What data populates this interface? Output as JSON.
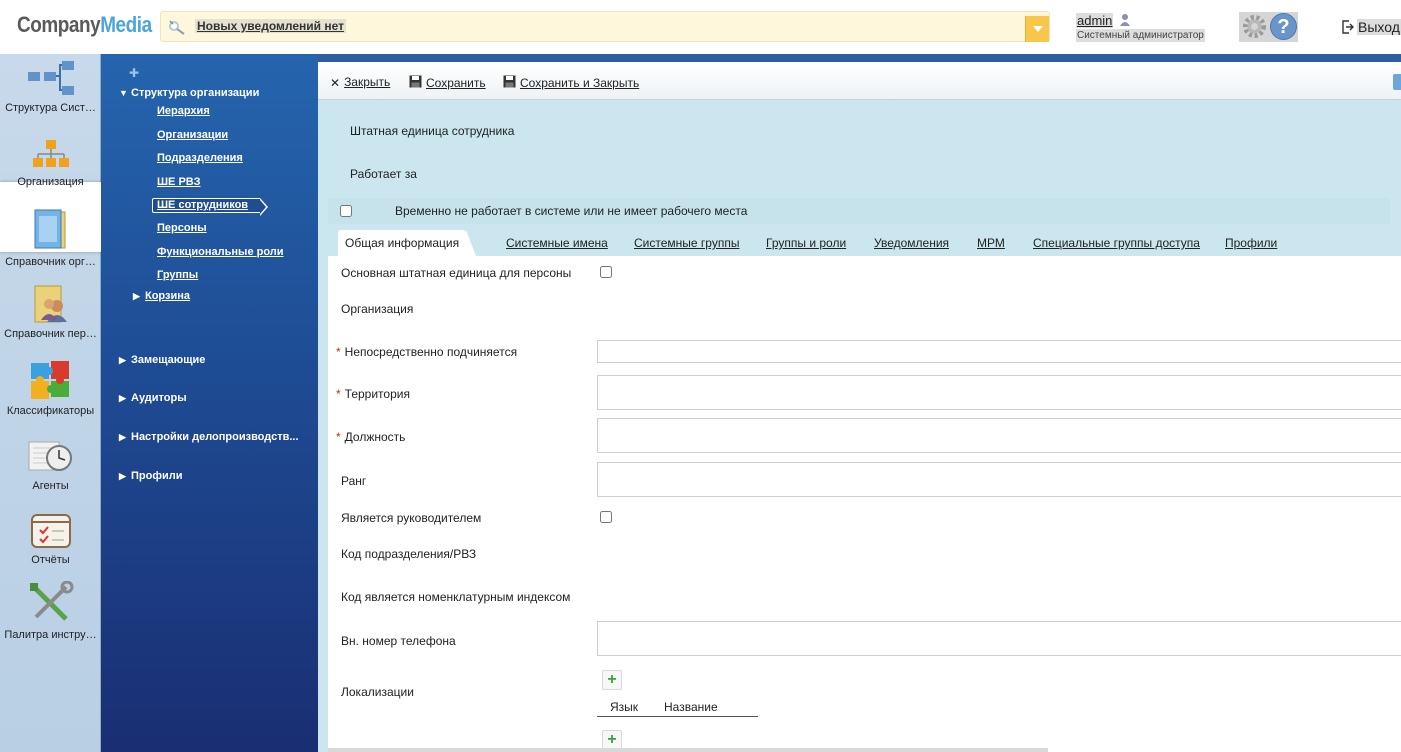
{
  "header": {
    "logo_part1": "Company",
    "logo_part2": "Media",
    "notification": "Новых уведомлений нет",
    "user_name": "admin",
    "user_role": "Системный администратор",
    "logout": "Выход"
  },
  "iconbar": {
    "items": [
      {
        "label": "Структура Сист…",
        "icon": "system-structure-icon"
      },
      {
        "label": "Организация",
        "icon": "organization-icon"
      },
      {
        "label": "Справочник орг…",
        "icon": "org-directory-icon"
      },
      {
        "label": "Справочник пер…",
        "icon": "person-directory-icon"
      },
      {
        "label": "Классификаторы",
        "icon": "puzzle-icon"
      },
      {
        "label": "Агенты",
        "icon": "clock-icon"
      },
      {
        "label": "Отчёты",
        "icon": "report-icon"
      },
      {
        "label": "Палитра инстру…",
        "icon": "tools-icon"
      }
    ]
  },
  "nav": {
    "structure": "Структура организации",
    "subitems": [
      "Иерархия",
      "Организации",
      "Подразделения",
      "ШЕ РВЗ",
      "ШЕ сотрудников",
      "Персоны",
      "Функциональные роли",
      "Группы"
    ],
    "basket": "Корзина",
    "substitutes": "Замещающие",
    "auditors": "Аудиторы",
    "settings": "Настройки делопроизводств...",
    "profiles": "Профили"
  },
  "toolbar": {
    "close": "Закрыть",
    "save": "Сохранить",
    "save_close": "Сохранить и Закрыть"
  },
  "form_header": {
    "staff_unit": "Штатная единица сотрудника",
    "works_for": "Работает за",
    "temp_absent": "Временно не работает в системе или не имеет рабочего места"
  },
  "tabs": [
    "Общая информация",
    "Системные имена",
    "Системные группы",
    "Группы и роли",
    "Уведомления",
    "МРМ",
    "Специальные группы доступа",
    "Профили"
  ],
  "form": {
    "main_unit": "Основная штатная единица для персоны",
    "organization": "Организация",
    "reports_to": "Непосредственно подчиняется",
    "territory": "Территория",
    "position": "Должность",
    "rank": "Ранг",
    "is_manager": "Является руководителем",
    "dept_code": "Код подразделения/РВЗ",
    "code_is_index": "Код является номенклатурным индексом",
    "phone": "Вн. номер телефона",
    "localizations": "Локализации",
    "col_lang": "Язык",
    "col_name": "Название",
    "add": "+"
  },
  "colors": {
    "nav_blue": "#1e4c94",
    "form_bg": "#cbe6ee",
    "required": "#dd2222",
    "add_green": "#3aa03a"
  }
}
